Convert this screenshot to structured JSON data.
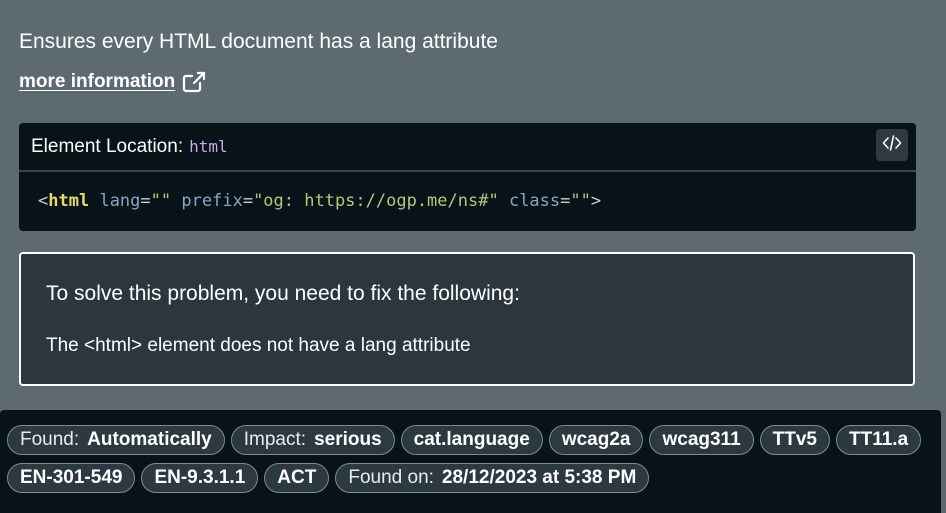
{
  "rule": {
    "description": "Ensures every HTML document has a lang attribute",
    "more_info_label": "more information"
  },
  "element_location": {
    "label": "Element Location:",
    "selector": "html",
    "code_toggle_icon": "code-icon"
  },
  "snippet": {
    "open_bracket": "<",
    "tag": "html",
    "attr1_name": "lang",
    "attr1_value": "\"\"",
    "attr2_name": "prefix",
    "attr2_value": "\"og: https://ogp.me/ns#\"",
    "attr3_name": "class",
    "attr3_value": "\"\"",
    "equals": "=",
    "close_bracket": ">"
  },
  "fix": {
    "title": "To solve this problem, you need to fix the following:",
    "items": [
      "The <html> element does not have a lang attribute"
    ]
  },
  "tags": {
    "found_key": "Found:",
    "found_value": "Automatically",
    "impact_key": "Impact:",
    "impact_value": "serious",
    "labels": [
      "cat.language",
      "wcag2a",
      "wcag311",
      "TTv5",
      "TT11.a",
      "EN-301-549",
      "EN-9.3.1.1",
      "ACT"
    ],
    "found_on_key": "Found on:",
    "found_on_value": "28/12/2023 at 5:38 PM"
  }
}
